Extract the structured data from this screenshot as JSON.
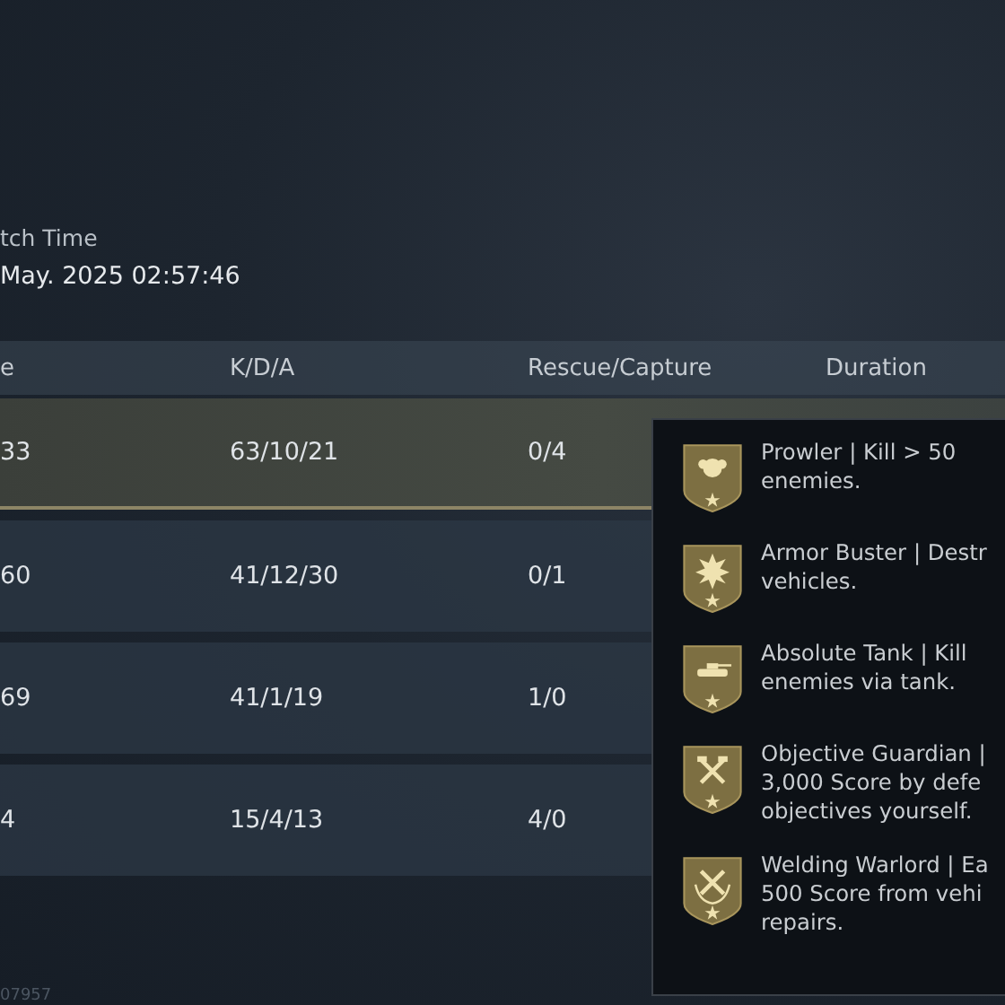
{
  "match_info": {
    "label": "tch Time",
    "value": "May. 2025 02:57:46"
  },
  "table": {
    "columns": [
      "e",
      "K/D/A",
      "Rescue/Capture",
      "Duration"
    ],
    "rows": [
      {
        "cells": [
          "33",
          "63/10/21",
          "0/4"
        ],
        "selected": true
      },
      {
        "cells": [
          "60",
          "41/12/30",
          "0/1"
        ],
        "selected": false
      },
      {
        "cells": [
          "69",
          "41/1/19",
          "1/0"
        ],
        "selected": false
      },
      {
        "cells": [
          "4",
          "15/4/13",
          "4/0"
        ],
        "selected": false
      }
    ]
  },
  "tooltip": {
    "achievements": [
      {
        "lines": [
          "Prowler | Kill > 50",
          "enemies."
        ]
      },
      {
        "lines": [
          "Armor Buster | Destr",
          "vehicles."
        ]
      },
      {
        "lines": [
          "Absolute Tank | Kill",
          "enemies via tank."
        ]
      },
      {
        "lines": [
          "Objective Guardian |",
          "3,000 Score by defe",
          "objectives yourself."
        ]
      },
      {
        "lines": [
          "Welding Warlord | Ea",
          "500 Score from vehi",
          "repairs."
        ]
      }
    ]
  },
  "footer": {
    "id": "07957"
  }
}
